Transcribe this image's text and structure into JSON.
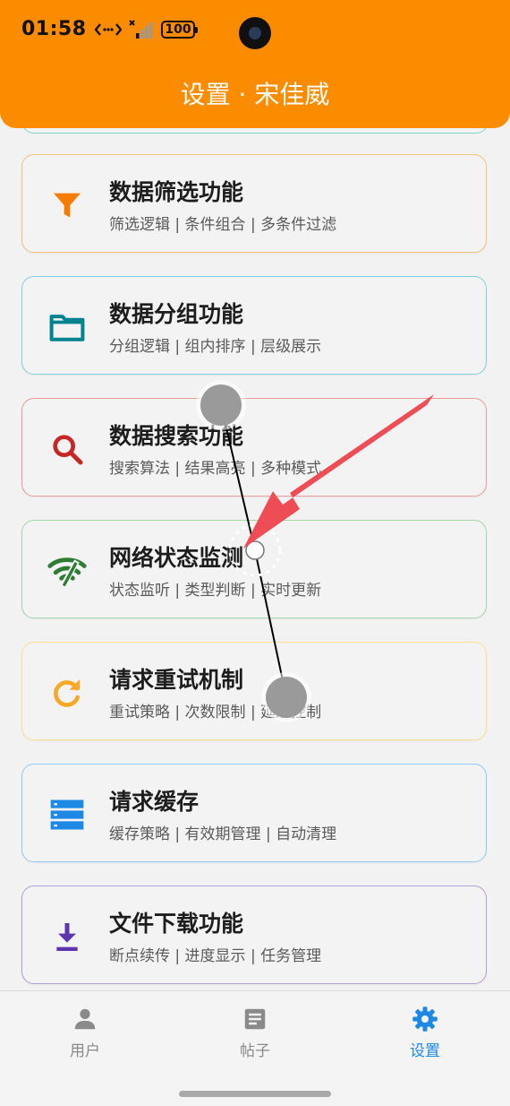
{
  "status_bar": {
    "time": "01:58",
    "battery": "100"
  },
  "header": {
    "title": "设置 · 宋佳威"
  },
  "colors": {
    "accent": "#fb8c00",
    "nav_active": "#1e88e5",
    "nav_inactive": "#8a8a8a"
  },
  "features": [
    {
      "title": "数据筛选功能",
      "subtitle": "筛选逻辑 | 条件组合 | 多条件过滤",
      "icon": "filter-icon",
      "color": "#f57c00",
      "border": "#f3c27f"
    },
    {
      "title": "数据分组功能",
      "subtitle": "分组逻辑 | 组内排序 | 层级展示",
      "icon": "folder-icon",
      "color": "#00838f",
      "border": "#7fd3dd"
    },
    {
      "title": "数据搜索功能",
      "subtitle": "搜索算法 | 结果高亮 | 多种模式",
      "icon": "search-icon",
      "color": "#c62828",
      "border": "#ef9a9a"
    },
    {
      "title": "网络状态监测",
      "subtitle": "状态监听 | 类型判断 | 实时更新",
      "icon": "wifi-off-icon",
      "color": "#2e7d32",
      "border": "#a5d6a7"
    },
    {
      "title": "请求重试机制",
      "subtitle": "重试策略 | 次数限制 | 延迟控制",
      "icon": "refresh-icon",
      "color": "#f9a825",
      "border": "#ffe08a"
    },
    {
      "title": "请求缓存",
      "subtitle": "缓存策略 | 有效期管理 | 自动清理",
      "icon": "storage-icon",
      "color": "#1e88e5",
      "border": "#90caf9"
    },
    {
      "title": "文件下载功能",
      "subtitle": "断点续传 | 进度显示 | 任务管理",
      "icon": "download-icon",
      "color": "#5e35b1",
      "border": "#b39ddb"
    }
  ],
  "nav": {
    "items": [
      {
        "label": "用户",
        "icon": "person-icon",
        "active": false
      },
      {
        "label": "帖子",
        "icon": "article-icon",
        "active": false
      },
      {
        "label": "设置",
        "icon": "gear-icon",
        "active": true
      }
    ]
  }
}
